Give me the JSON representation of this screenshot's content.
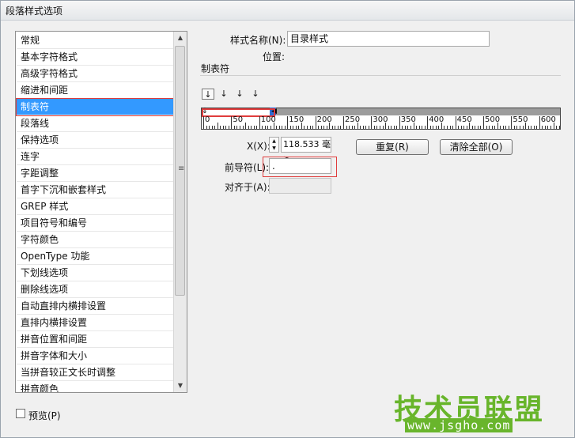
{
  "window": {
    "title": "段落样式选项"
  },
  "categories": [
    {
      "label": "常规"
    },
    {
      "label": "基本字符格式"
    },
    {
      "label": "高级字符格式"
    },
    {
      "label": "缩进和间距"
    },
    {
      "label": "制表符",
      "selected": true
    },
    {
      "label": "段落线"
    },
    {
      "label": "保持选项"
    },
    {
      "label": "连字"
    },
    {
      "label": "字距调整"
    },
    {
      "label": "首字下沉和嵌套样式"
    },
    {
      "label": "GREP 样式"
    },
    {
      "label": "项目符号和编号"
    },
    {
      "label": "字符颜色"
    },
    {
      "label": "OpenType 功能"
    },
    {
      "label": "下划线选项"
    },
    {
      "label": "删除线选项"
    },
    {
      "label": "自动直排内横排设置"
    },
    {
      "label": "直排内横排设置"
    },
    {
      "label": "拼音位置和间距"
    },
    {
      "label": "拼音字体和大小"
    },
    {
      "label": "当拼音较正文长时调整"
    },
    {
      "label": "拼音颜色"
    }
  ],
  "style_name": {
    "label": "样式名称(N):",
    "value": "目录样式"
  },
  "location": {
    "label": "位置:"
  },
  "section": {
    "title": "制表符"
  },
  "tab_types": [
    {
      "icon": "left-tab-icon",
      "glyph": "↓",
      "active": true
    },
    {
      "icon": "center-tab-icon",
      "glyph": "↓"
    },
    {
      "icon": "right-tab-icon",
      "glyph": "↓"
    },
    {
      "icon": "decimal-tab-icon",
      "glyph": "↓"
    }
  ],
  "ruler": {
    "labels": [
      "0",
      "50",
      "100",
      "150",
      "200",
      "250",
      "300",
      "350",
      "400",
      "450",
      "500",
      "550",
      "600"
    ]
  },
  "x_field": {
    "label": "X(X):",
    "value": "118.533 毫>"
  },
  "buttons": {
    "repeat": "重复(R)",
    "clear_all": "清除全部(O)"
  },
  "leader": {
    "label": "前导符(L):",
    "value": "."
  },
  "align_on": {
    "label": "对齐于(A):",
    "value": ""
  },
  "preview": {
    "label": "预览(P)",
    "checked": false
  },
  "watermark": {
    "main": "技术员联盟",
    "sub": "www.jsgho.com"
  },
  "colors": {
    "selection": "#3399ff",
    "highlight": "#e03c3c",
    "watermark": "#68b52b"
  }
}
